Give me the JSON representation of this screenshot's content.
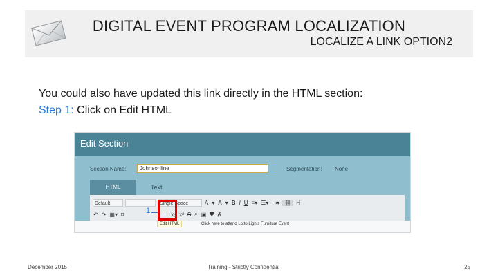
{
  "slide": {
    "title": "DIGITAL EVENT PROGRAM LOCALIZATION",
    "subtitle": "LOCALIZE A LINK OPTION2",
    "body_line1": "You could also have updated this link directly in the HTML section:",
    "step_label": "Step 1:",
    "step_text": " Click on Edit HTML",
    "header_icon": "envelope-icon"
  },
  "screenshot": {
    "header_title": "Edit Section",
    "section_name_label": "Section Name:",
    "section_name_value": "Johnsonline",
    "segmentation_label": "Segmentation:",
    "segmentation_value": "None",
    "tabs": [
      "HTML",
      "Text"
    ],
    "toolbar_row1": {
      "font_select": "Default",
      "size_select": "",
      "spacing_select": "Single Space",
      "buttons": [
        "A",
        "B",
        "I",
        "U"
      ]
    },
    "toolbar_row2_buttons": [
      "x₂",
      "x²",
      "S"
    ],
    "highlight_glyph": "…",
    "annotation_number": "1",
    "tooltip": "Edit HTML",
    "hint": "Click here to attend Lotto Lights Furniture Event"
  },
  "footer": {
    "date": "December 2015",
    "confidential": "Training - Strictly Confidential",
    "page": "25"
  },
  "colors": {
    "accent_blue": "#2a7ad5",
    "screenshot_header": "#4a8296",
    "screenshot_band": "#8fbfcf",
    "highlight_red": "#e00000"
  }
}
